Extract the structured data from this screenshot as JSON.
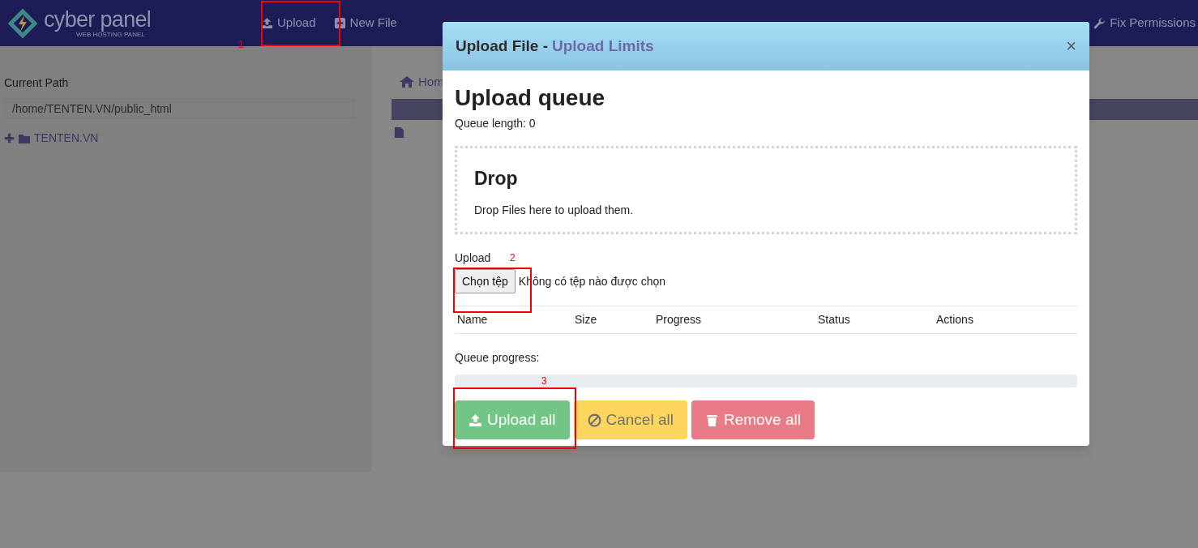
{
  "navbar": {
    "logo_text": "cyber panel",
    "logo_tagline": "WEB HOSTING PANEL",
    "items": [
      {
        "label": "Upload",
        "kind": "upload"
      },
      {
        "label": "New File",
        "kind": "plus"
      },
      {
        "label": "Fix Permissions",
        "kind": "wrench"
      }
    ]
  },
  "sidebar": {
    "label": "Current Path",
    "path": "/home/TENTEN.VN/public_html",
    "tree": [
      {
        "label": "TENTEN.VN",
        "expanded": false
      }
    ]
  },
  "breadcrumb": {
    "label": "Hom"
  },
  "modal": {
    "title": "Upload File -",
    "title_link": "Upload Limits",
    "close": "×",
    "heading": "Upload queue",
    "queue_length": "Queue length: 0",
    "drop_zone": {
      "title": "Drop",
      "text": "Drop Files here to upload them."
    },
    "upload_label": "Upload",
    "file_button": "Chọn tệp",
    "file_status": "Không có tệp nào được chọn",
    "columns": [
      "Name",
      "Size",
      "Progress",
      "Status",
      "Actions"
    ],
    "queue_progress_label": "Queue progress:",
    "queue_progress": {
      "level": 0
    },
    "buttons": [
      {
        "label": "Upload all",
        "kind": "success",
        "disabled": true
      },
      {
        "label": "Cancel all",
        "kind": "warning",
        "disabled": true
      },
      {
        "label": "Remove all",
        "kind": "danger",
        "disabled": true
      }
    ]
  },
  "annotations": [
    {
      "label": "1"
    },
    {
      "label": "2"
    },
    {
      "label": "3"
    }
  ]
}
